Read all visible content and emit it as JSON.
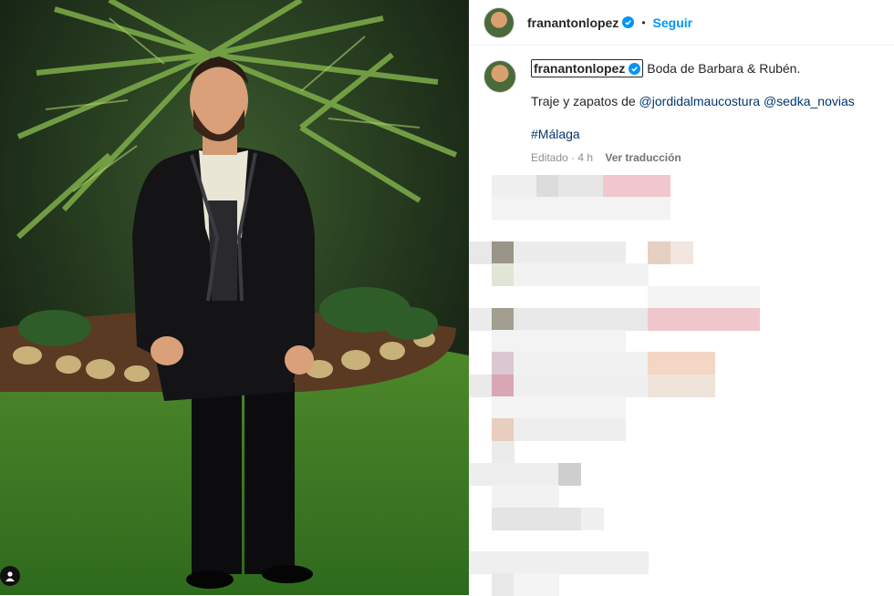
{
  "post": {
    "username": "franantonlopez",
    "follow_label": "Seguir",
    "separator": "•"
  },
  "caption": {
    "username": "franantonlopez",
    "title": "Boda de Barbara & Rubén.",
    "line2_prefix": "Traje y zapatos de ",
    "mention1": "@jordidalmaucostura",
    "mention2": "@sedka_novias",
    "hashtag": "#Málaga",
    "edited": "Editado · 4 h",
    "translate": "Ver traducción"
  },
  "colors": {
    "follow": "#0095f6",
    "verified": "#0095f6",
    "link": "#00376b"
  }
}
